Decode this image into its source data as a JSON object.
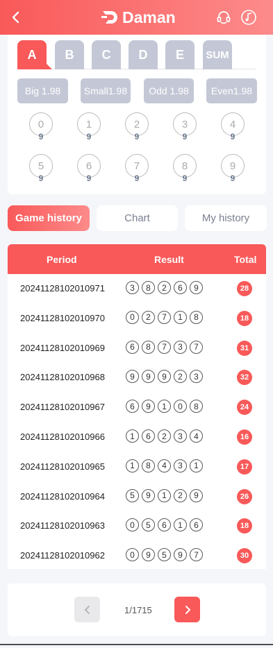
{
  "header": {
    "brand": "Daman"
  },
  "colors": {
    "accent": "#f95959",
    "inactive_tab": "#c4c8d6"
  },
  "icons": [
    "chevron-left-icon",
    "daman-logo-icon",
    "headset-icon",
    "music-note-icon",
    "chevron-right-icon"
  ],
  "position_tabs": [
    "A",
    "B",
    "C",
    "D",
    "E",
    "SUM"
  ],
  "active_position_tab": "A",
  "bet_options": [
    "Big 1.98",
    "Small1.98",
    "Odd 1.98",
    "Even1.98"
  ],
  "number_balls": [
    {
      "num": "0",
      "count": "9"
    },
    {
      "num": "1",
      "count": "9"
    },
    {
      "num": "2",
      "count": "9"
    },
    {
      "num": "3",
      "count": "9"
    },
    {
      "num": "4",
      "count": "9"
    },
    {
      "num": "5",
      "count": "9"
    },
    {
      "num": "6",
      "count": "9"
    },
    {
      "num": "7",
      "count": "9"
    },
    {
      "num": "8",
      "count": "9"
    },
    {
      "num": "9",
      "count": "9"
    }
  ],
  "history_tabs": [
    "Game history",
    "Chart",
    "My history"
  ],
  "table": {
    "headers": {
      "period": "Period",
      "result": "Result",
      "total": "Total"
    },
    "rows": [
      {
        "period": "20241128102010971",
        "digits": [
          "3",
          "8",
          "2",
          "6",
          "9"
        ],
        "total": "28"
      },
      {
        "period": "20241128102010970",
        "digits": [
          "0",
          "2",
          "7",
          "1",
          "8"
        ],
        "total": "18"
      },
      {
        "period": "20241128102010969",
        "digits": [
          "6",
          "8",
          "7",
          "3",
          "7"
        ],
        "total": "31"
      },
      {
        "period": "20241128102010968",
        "digits": [
          "9",
          "9",
          "9",
          "2",
          "3"
        ],
        "total": "32"
      },
      {
        "period": "20241128102010967",
        "digits": [
          "6",
          "9",
          "1",
          "0",
          "8"
        ],
        "total": "24"
      },
      {
        "period": "20241128102010966",
        "digits": [
          "1",
          "6",
          "2",
          "3",
          "4"
        ],
        "total": "16"
      },
      {
        "period": "20241128102010965",
        "digits": [
          "1",
          "8",
          "4",
          "3",
          "1"
        ],
        "total": "17"
      },
      {
        "period": "20241128102010964",
        "digits": [
          "5",
          "9",
          "1",
          "2",
          "9"
        ],
        "total": "26"
      },
      {
        "period": "20241128102010963",
        "digits": [
          "0",
          "5",
          "6",
          "1",
          "6"
        ],
        "total": "18"
      },
      {
        "period": "20241128102010962",
        "digits": [
          "0",
          "9",
          "5",
          "9",
          "7"
        ],
        "total": "30"
      }
    ]
  },
  "pagination": {
    "text": "1/1715"
  }
}
